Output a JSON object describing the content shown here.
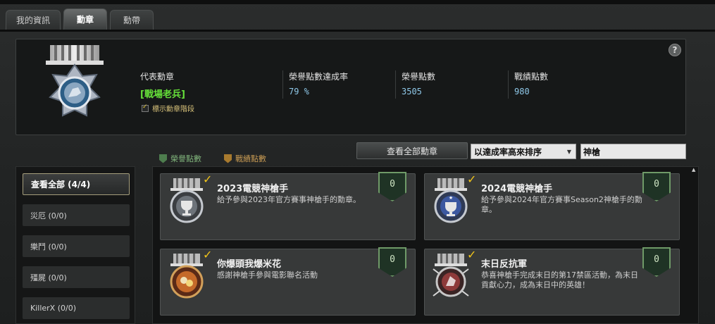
{
  "tabs": [
    {
      "label": "我的資訊",
      "active": false
    },
    {
      "label": "勳章",
      "active": true
    },
    {
      "label": "勳帶",
      "active": false
    }
  ],
  "help": {
    "label": "?"
  },
  "summary": {
    "rep_label": "代表勳章",
    "rep_value": "[戰場老兵]",
    "rate_label": "榮譽點數達成率",
    "rate_value": "79 %",
    "honor_label": "榮譽點數",
    "honor_value": "3505",
    "war_label": "戰績點數",
    "war_value": "980",
    "show_stage_label": "標示勳章階段",
    "show_stage_checked": true
  },
  "legend": {
    "honor": {
      "label": "榮譽點數",
      "color": "#4e7d4e"
    },
    "war": {
      "label": "戰績點數",
      "color": "#a87a2e"
    }
  },
  "controls": {
    "view_all": "查看全部勳章",
    "sort_value": "以達成率高來排序",
    "search_value": "神槍"
  },
  "categories": [
    {
      "label": "查看全部 (4/4)",
      "active": true
    },
    {
      "label": "災厄 (0/0)",
      "active": false
    },
    {
      "label": "樂鬥 (0/0)",
      "active": false
    },
    {
      "label": "殭屍 (0/0)",
      "active": false
    },
    {
      "label": "KillerX (0/0)",
      "active": false
    }
  ],
  "medals": [
    {
      "title": "2023電競神槍手",
      "desc": "給予參與2023年官方賽事神槍手的勳章。",
      "points": "0",
      "icon": "trophy-medal-icon"
    },
    {
      "title": "2024電競神槍手",
      "desc": "給予參與2024年官方賽事Season2神槍手的勳章。",
      "points": "0",
      "icon": "star-trophy-medal-icon"
    },
    {
      "title": "你爆頭我爆米花",
      "desc": "感謝神槍手參與電影聯名活動",
      "points": "0",
      "icon": "popcorn-medal-icon"
    },
    {
      "title": "末日反抗軍",
      "desc": "恭喜神槍手完成末日的第17禁區活動，為末日貢獻心力，成為末日中的英雄！",
      "points": "0",
      "icon": "rebel-medal-icon"
    }
  ]
}
